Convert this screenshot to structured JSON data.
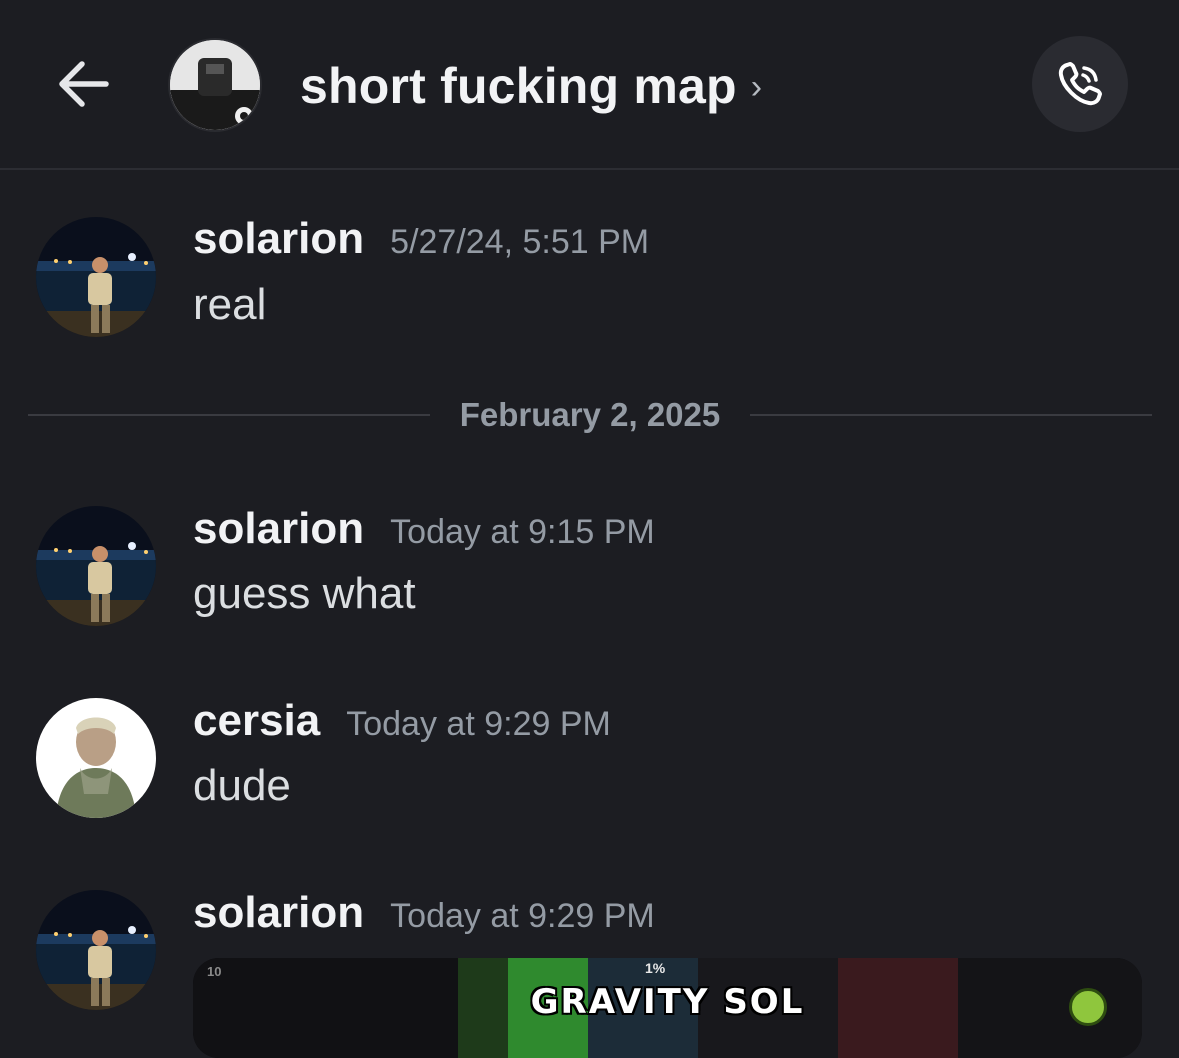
{
  "header": {
    "title": "short fucking map",
    "chevron": "›",
    "back_icon": "arrow-left-icon",
    "call_icon": "phone-call-icon"
  },
  "messages": [
    {
      "author": "solarion",
      "time": "5/27/24, 5:51 PM",
      "content": "real"
    },
    {
      "author": "solarion",
      "time": "Today at 9:15 PM",
      "content": "guess what"
    },
    {
      "author": "cersia",
      "time": "Today at 9:29 PM",
      "content": "dude"
    },
    {
      "author": "solarion",
      "time": "Today at 9:29 PM",
      "content": ""
    }
  ],
  "date_divider": "February 2, 2025",
  "embed": {
    "title": "GRAVITY SOL",
    "progress": "1%",
    "level_label": "10"
  },
  "colors": {
    "background": "#1c1d22",
    "author": "#f2f3f5",
    "timestamp": "#949ba4",
    "text": "#dbdee1"
  }
}
